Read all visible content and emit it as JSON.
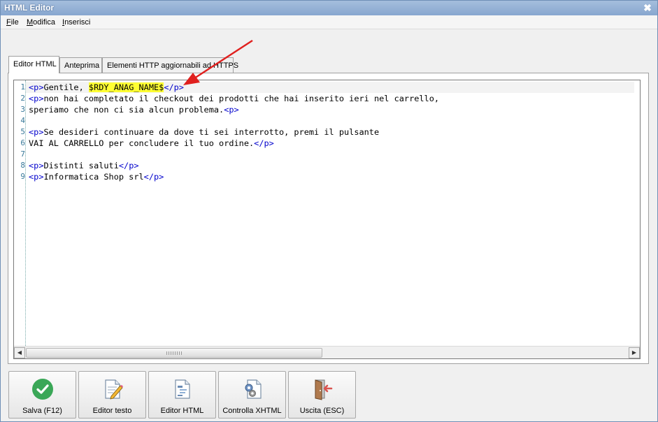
{
  "window": {
    "title": "HTML Editor",
    "close_glyph": "✖"
  },
  "menu": [
    {
      "accel": "F",
      "rest": "ile"
    },
    {
      "accel": "M",
      "rest": "odifica"
    },
    {
      "accel": "I",
      "rest": "nserisci"
    }
  ],
  "tabs": [
    "Editor HTML",
    "Anteprima",
    "Elementi HTTP aggiornabili ad HTTPS"
  ],
  "active_tab": "Editor HTML",
  "editor": {
    "line_numbers": [
      "1",
      "2",
      "3",
      "4",
      "5",
      "6",
      "7",
      "8",
      "9"
    ],
    "lines": {
      "l1_open": "<p>",
      "l1_text": "Gentile, ",
      "l1_var": "$RDY_ANAG_NAME$",
      "l1_close": "</p>",
      "l2_open": "<p>",
      "l2_text": "non hai completato il checkout dei prodotti che hai inserito ieri nel carrello,",
      "l3_text": "speriamo che non ci sia alcun problema.",
      "l3_open": "<p>",
      "l5_open": "<p>",
      "l5_text": "Se desideri continuare da dove ti sei interrotto, premi il pulsante",
      "l6_text": "VAI AL CARRELLO per concludere il tuo ordine.",
      "l6_close": "</p>",
      "l8_open": "<p>",
      "l8_text": "Distinti saluti",
      "l8_close": "</p>",
      "l9_open": "<p>",
      "l9_text": "Informatica Shop srl",
      "l9_close": "</p>"
    },
    "horizontal_scroll_position": 0
  },
  "toolbar": [
    {
      "label": "Salva (F12)",
      "icon": "check-circle-icon",
      "color": "#3aa757"
    },
    {
      "label": "Editor testo",
      "icon": "edit-document-icon"
    },
    {
      "label": "Editor HTML",
      "icon": "html-document-icon"
    },
    {
      "label": "Controlla XHTML",
      "icon": "gear-document-icon"
    },
    {
      "label": "Uscita (ESC)",
      "icon": "exit-door-icon",
      "color": "#d9534f"
    }
  ],
  "annotation_arrow_color": "#e0201e"
}
